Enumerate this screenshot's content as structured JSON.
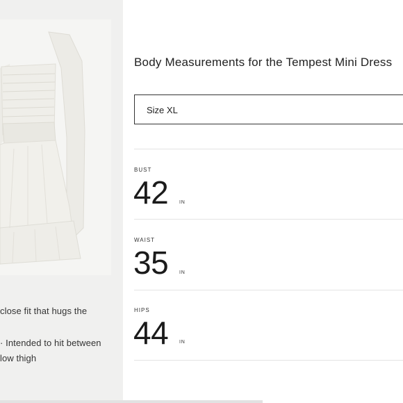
{
  "product": {
    "image_alt": "white smocked mini dress with long sleeves"
  },
  "description": {
    "line1": "close fit that hugs the",
    "line2": "· Intended to hit between",
    "line3": "low thigh"
  },
  "panel": {
    "title": "Body Measurements for the Tempest Mini Dress",
    "size_select_value": "Size XL"
  },
  "measurements": [
    {
      "label": "BUST",
      "value": "42",
      "unit": "IN"
    },
    {
      "label": "WAIST",
      "value": "35",
      "unit": "IN"
    },
    {
      "label": "HIPS",
      "value": "44",
      "unit": "IN"
    }
  ]
}
